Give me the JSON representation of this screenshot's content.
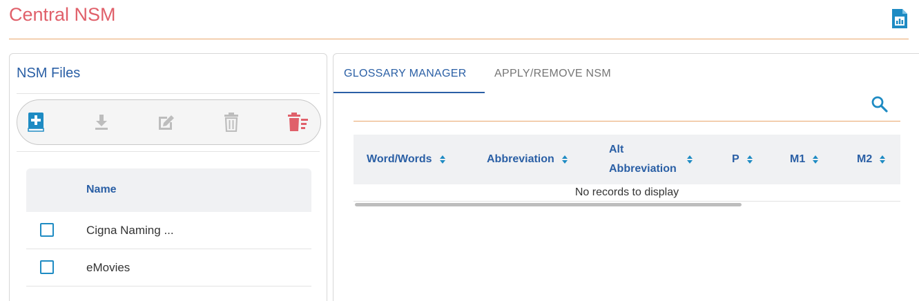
{
  "header": {
    "title": "Central NSM",
    "report_icon": "report-icon"
  },
  "left_panel": {
    "title": "NSM Files",
    "toolbar": [
      {
        "name": "add-file-button",
        "icon": "book-plus-icon",
        "state": "enabled"
      },
      {
        "name": "download-button",
        "icon": "download-icon",
        "state": "disabled"
      },
      {
        "name": "edit-button",
        "icon": "edit-icon",
        "state": "disabled"
      },
      {
        "name": "delete-button",
        "icon": "trash-icon",
        "state": "disabled"
      },
      {
        "name": "delete-all-button",
        "icon": "trash-list-icon",
        "state": "enabled"
      }
    ],
    "table": {
      "header": "Name",
      "rows": [
        {
          "name": "Cigna Naming ...",
          "checked": false
        },
        {
          "name": "eMovies",
          "checked": false
        }
      ]
    }
  },
  "right_panel": {
    "tabs": [
      {
        "label": "GLOSSARY MANAGER",
        "active": true
      },
      {
        "label": "APPLY/REMOVE NSM",
        "active": false
      }
    ],
    "grid": {
      "columns": [
        {
          "line1": "Word/Words",
          "line2": ""
        },
        {
          "line1": "Abbreviation",
          "line2": ""
        },
        {
          "line1": "Alt",
          "line2": "Abbreviation"
        },
        {
          "line1": "P",
          "line2": ""
        },
        {
          "line1": "M1",
          "line2": ""
        },
        {
          "line1": "M2",
          "line2": ""
        }
      ],
      "empty_message": "No records to display"
    }
  },
  "colors": {
    "title": "#e0606a",
    "accent_blue": "#2a5fa5",
    "icon_blue": "#1e8bc3",
    "divider_orange": "#e9a66b",
    "danger_red": "#e0606a",
    "disabled_gray": "#bdbdbd"
  }
}
